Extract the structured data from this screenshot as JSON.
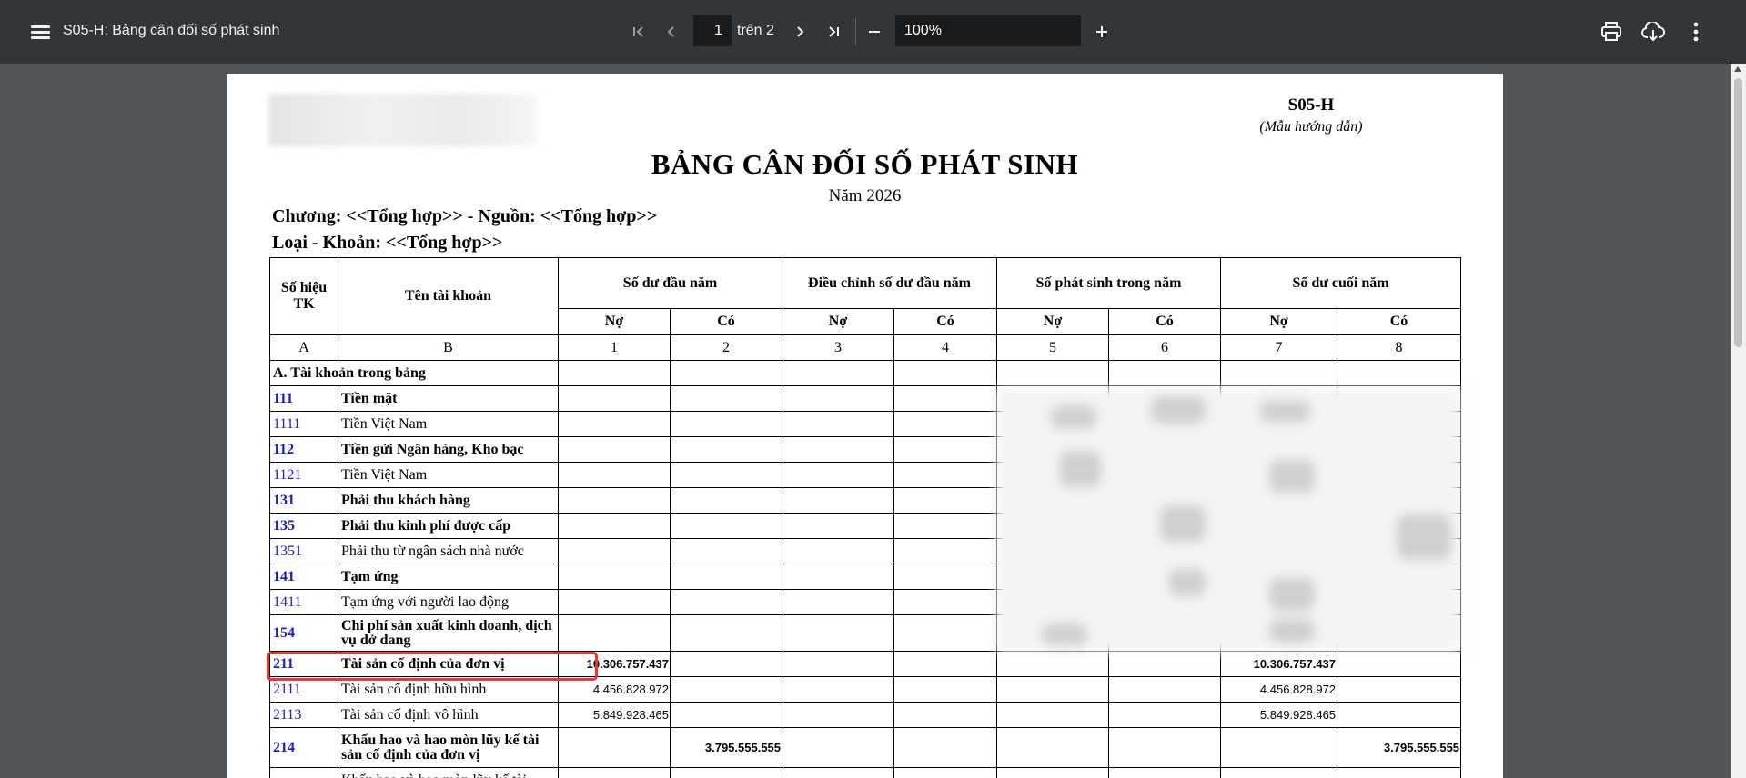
{
  "toolbar": {
    "title": "S05-H: Bảng cân đối số phát sinh",
    "page_current": "1",
    "page_of": "trên 2",
    "zoom": "100%",
    "icons": [
      "menu-icon",
      "first-page-icon",
      "prev-page-icon",
      "next-page-icon",
      "last-page-icon",
      "zoom-out-icon",
      "zoom-in-icon",
      "print-icon",
      "download-icon",
      "more-vert-icon"
    ]
  },
  "document": {
    "code": "S05-H",
    "code_sub": "(Mẫu hướng dẫn)",
    "title": "BẢNG CÂN ĐỐI SỐ PHÁT SINH",
    "year": "Năm 2026",
    "chuong": "Chương: <<Tổng hợp>> - Nguồn: <<Tổng hợp>>",
    "loai": "Loại - Khoản: <<Tổng hợp>>"
  },
  "table": {
    "headers": {
      "so_hieu": "Số hiệu TK",
      "ten": "Tên tài khoản",
      "groups": [
        "Số dư đầu năm",
        "Điều chỉnh số dư đầu năm",
        "Số phát sinh trong năm",
        "Số dư cuối năm"
      ],
      "no": "Nợ",
      "co": "Có",
      "index": [
        "A",
        "B",
        "1",
        "2",
        "3",
        "4",
        "5",
        "6",
        "7",
        "8"
      ]
    },
    "section_a": "A. Tài khoản trong bảng",
    "rows": [
      {
        "code": "111",
        "name": "Tiền mặt",
        "bold": true
      },
      {
        "code": "1111",
        "name": "Tiền Việt Nam",
        "bold": false
      },
      {
        "code": "112",
        "name": "Tiền gửi Ngân hàng, Kho bạc",
        "bold": true
      },
      {
        "code": "1121",
        "name": "Tiền Việt Nam",
        "bold": false
      },
      {
        "code": "131",
        "name": "Phải thu khách hàng",
        "bold": true
      },
      {
        "code": "135",
        "name": "Phải thu kinh phí được cấp",
        "bold": true
      },
      {
        "code": "1351",
        "name": "Phải thu từ ngân sách nhà nước",
        "bold": false
      },
      {
        "code": "141",
        "name": "Tạm ứng",
        "bold": true
      },
      {
        "code": "1411",
        "name": "Tạm ứng với người lao động",
        "bold": false
      },
      {
        "code": "154",
        "name": "Chi phí sản xuất kinh doanh, dịch vụ dở dang",
        "bold": true
      },
      {
        "code": "211",
        "name": "Tài sản cố định của đơn vị",
        "bold": true,
        "c1": "10.306.757.437",
        "c7": "10.306.757.437"
      },
      {
        "code": "2111",
        "name": "Tài sản cố định hữu hình",
        "bold": false,
        "c1": "4.456.828.972",
        "c7": "4.456.828.972"
      },
      {
        "code": "2113",
        "name": "Tài sản cố định vô hình",
        "bold": false,
        "c1": "5.849.928.465",
        "c7": "5.849.928.465"
      },
      {
        "code": "214",
        "name": "Khấu hao và hao mòn lũy kế tài sản cố định của đơn vị",
        "bold": true,
        "c2": "3.795.555.555",
        "c8": "3.795.555.555"
      },
      {
        "code": "",
        "name": "Khấu hao và hao mòn lũy kế tài",
        "bold": false
      }
    ]
  }
}
